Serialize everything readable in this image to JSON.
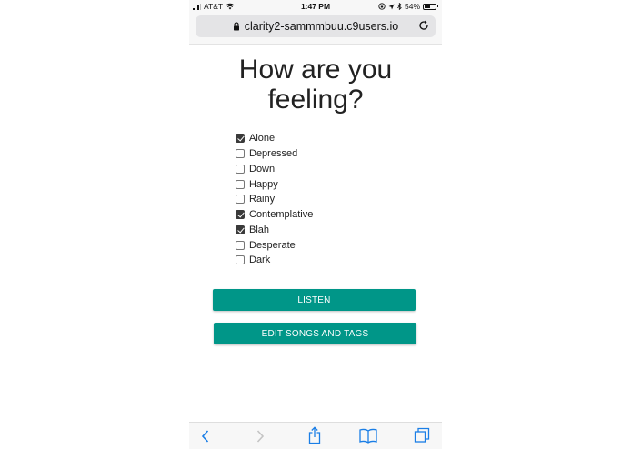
{
  "status_bar": {
    "carrier": "AT&T",
    "time": "1:47 PM",
    "battery": "54%",
    "battery_level": 0.54,
    "icons": [
      "signal-icon",
      "wifi-icon",
      "orientation-lock-icon",
      "location-icon",
      "bluetooth-icon",
      "battery-icon"
    ]
  },
  "browser": {
    "url": "clarity2-sammmbuu.c9users.io",
    "icons": [
      "lock-icon",
      "reload-icon"
    ]
  },
  "page": {
    "title_line1": "How are you",
    "title_line2": "feeling?",
    "moods": [
      {
        "label": "Alone",
        "checked": true
      },
      {
        "label": "Depressed",
        "checked": false
      },
      {
        "label": "Down",
        "checked": false
      },
      {
        "label": "Happy",
        "checked": false
      },
      {
        "label": "Rainy",
        "checked": false
      },
      {
        "label": "Contemplative",
        "checked": true
      },
      {
        "label": "Blah",
        "checked": true
      },
      {
        "label": "Desperate",
        "checked": false
      },
      {
        "label": "Dark",
        "checked": false
      }
    ],
    "listen_label": "LISTEN",
    "edit_label": "EDIT SONGS AND TAGS"
  },
  "toolbar": {
    "icons": [
      "back-icon",
      "forward-icon",
      "share-icon",
      "bookmarks-icon",
      "tabs-icon"
    ]
  },
  "colors": {
    "button": "#009688",
    "accent": "#1a7ee6",
    "disabled": "#b8b8b8"
  }
}
